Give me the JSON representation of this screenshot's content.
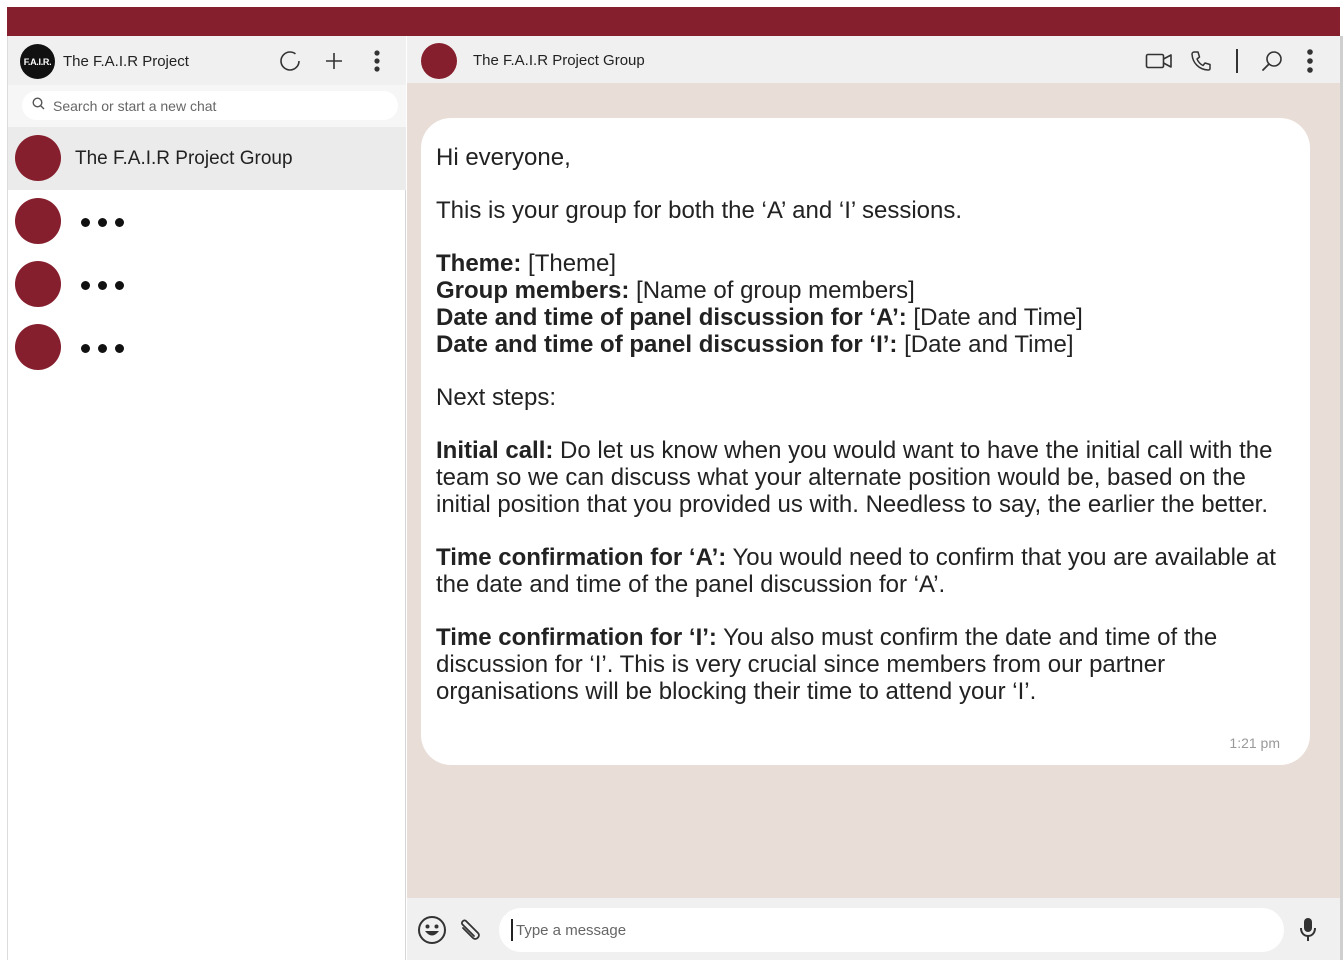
{
  "app": {
    "brand_color": "#861f2d",
    "logo_text": "F.A.I.R.",
    "title": "The F.A.I.R Project"
  },
  "search": {
    "placeholder": "Search or start a new chat"
  },
  "chats": [
    {
      "name": "The F.A.I.R Project Group",
      "active": true
    },
    {
      "name": "",
      "active": false
    },
    {
      "name": "",
      "active": false
    },
    {
      "name": "",
      "active": false
    }
  ],
  "conversation": {
    "title": "The F.A.I.R Project Group",
    "message": {
      "greeting": "Hi everyone,",
      "intro": "This is your group for both the ‘A’ and ‘I’ sessions.",
      "theme_label": "Theme:",
      "theme_value": " [Theme]",
      "members_label": "Group members:",
      "members_value": " [Name of group members]",
      "date_a_label": "Date and time of panel discussion for ‘A’:",
      "date_a_value": " [Date and Time]",
      "date_i_label": "Date and time of panel discussion for ‘I’:",
      "date_i_value": " [Date and Time]",
      "next_steps": "Next steps:",
      "initial_label": "Initial call:",
      "initial_text": " Do let us know when you would want to have the initial call with the team so we can discuss what your alternate position would be, based on the initial position that you provided us with. Needless to say, the earlier the better.",
      "confirm_a_label": "Time confirmation for ‘A’:",
      "confirm_a_text": " You would need to confirm that you are available at the date and time of the panel discussion for ‘A’.",
      "confirm_i_label": "Time confirmation for ‘I’:",
      "confirm_i_text": " You also must confirm the date and time of the discussion for ‘I’. This is very crucial since members from our partner organisations will be blocking their time to attend your ‘I’.",
      "time": "1:21 pm"
    }
  },
  "composer": {
    "placeholder": "Type a message"
  },
  "icons": {
    "left_header": [
      "status-icon",
      "new-chat-icon",
      "menu-icon"
    ],
    "right_header": [
      "video-call-icon",
      "voice-call-icon",
      "search-icon",
      "menu-icon"
    ],
    "composer": [
      "emoji-icon",
      "attach-icon",
      "microphone-icon"
    ]
  }
}
